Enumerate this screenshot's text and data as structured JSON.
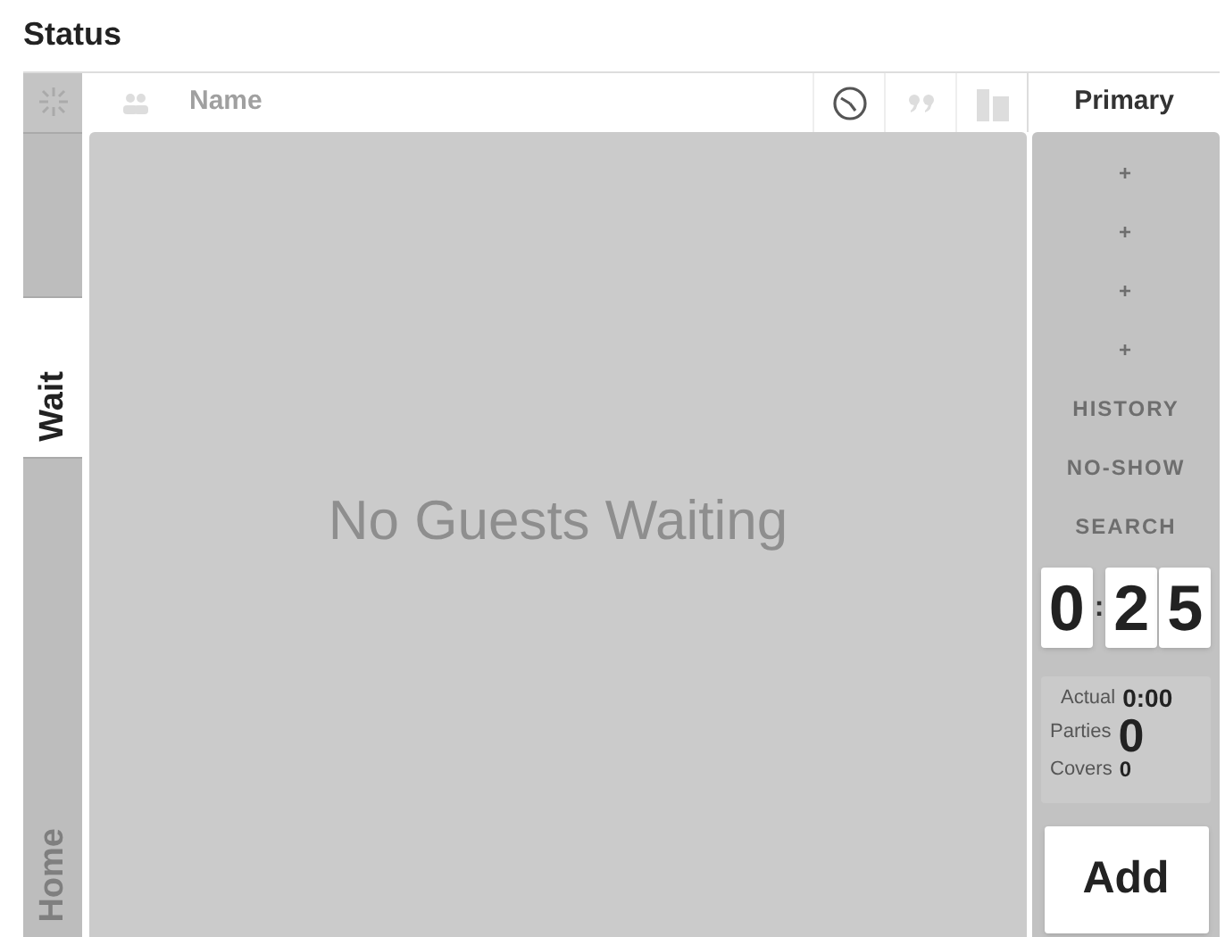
{
  "page_title": "Status",
  "side_tabs": [
    {
      "selected": false
    },
    {
      "label": "Wait",
      "selected": true
    },
    {
      "label": "Home",
      "selected": false
    }
  ],
  "list_header": {
    "name_label": "Name",
    "icons": [
      {
        "kind": "clock",
        "active": true
      },
      {
        "kind": "quote",
        "active": false
      },
      {
        "kind": "table",
        "active": false
      }
    ]
  },
  "empty_message": "No Guests Waiting",
  "right_panel": {
    "title": "Primary",
    "actions": [
      {
        "label": "+"
      },
      {
        "label": "+"
      },
      {
        "label": "+"
      },
      {
        "label": "+"
      },
      {
        "label": "HISTORY"
      },
      {
        "label": "NO-SHOW"
      },
      {
        "label": "SEARCH"
      }
    ],
    "wait_timer": {
      "digits": [
        "0",
        "2",
        "5"
      ],
      "separator": ":"
    },
    "stats": [
      {
        "label": "Actual",
        "value": "0:00",
        "kind": "medium"
      },
      {
        "label": "Parties",
        "value": "0",
        "kind": "large"
      },
      {
        "label": "Covers",
        "value": "0",
        "kind": "small"
      }
    ],
    "add_button": "Add"
  }
}
